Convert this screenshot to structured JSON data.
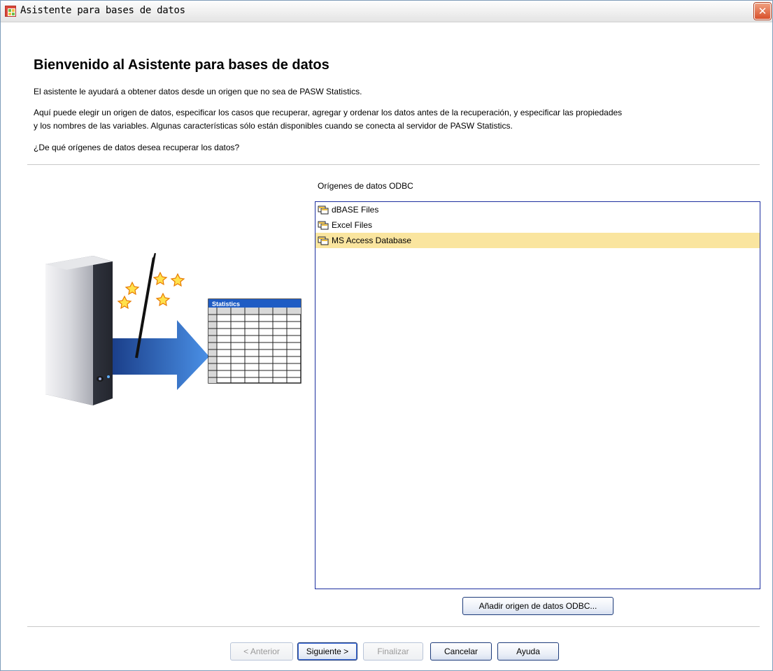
{
  "window": {
    "title": "Asistente para bases de datos",
    "close_label": "✕"
  },
  "page": {
    "title": "Bienvenido al Asistente para bases de datos",
    "intro": "El asistente le ayudará a obtener datos desde un origen que no sea de PASW Statistics.",
    "description_line1": "Aquí puede elegir un origen de datos, especificar los casos que recuperar, agregar y ordenar los datos antes de la recuperación, y especificar las propiedades",
    "description_line2": "y los nombres de las variables. Algunas características sólo están disponibles cuando se conecta al servidor de PASW Statistics.",
    "question": "¿De qué orígenes de datos desea recuperar los datos?"
  },
  "illustration": {
    "table_header": "Statistics"
  },
  "odbc": {
    "label": "Orígenes de datos ODBC",
    "items": [
      {
        "label": "dBASE Files",
        "selected": false
      },
      {
        "label": "Excel Files",
        "selected": false
      },
      {
        "label": "MS Access Database",
        "selected": true
      }
    ],
    "add_button": "Añadir origen de datos ODBC..."
  },
  "footer": {
    "back": "< Anterior",
    "next": "Siguiente >",
    "finish": "Finalizar",
    "cancel": "Cancelar",
    "help": "Ayuda"
  },
  "colors": {
    "selection": "#fae59f",
    "listbox_border": "#1c2f9f",
    "close_button": "#d8502a"
  }
}
